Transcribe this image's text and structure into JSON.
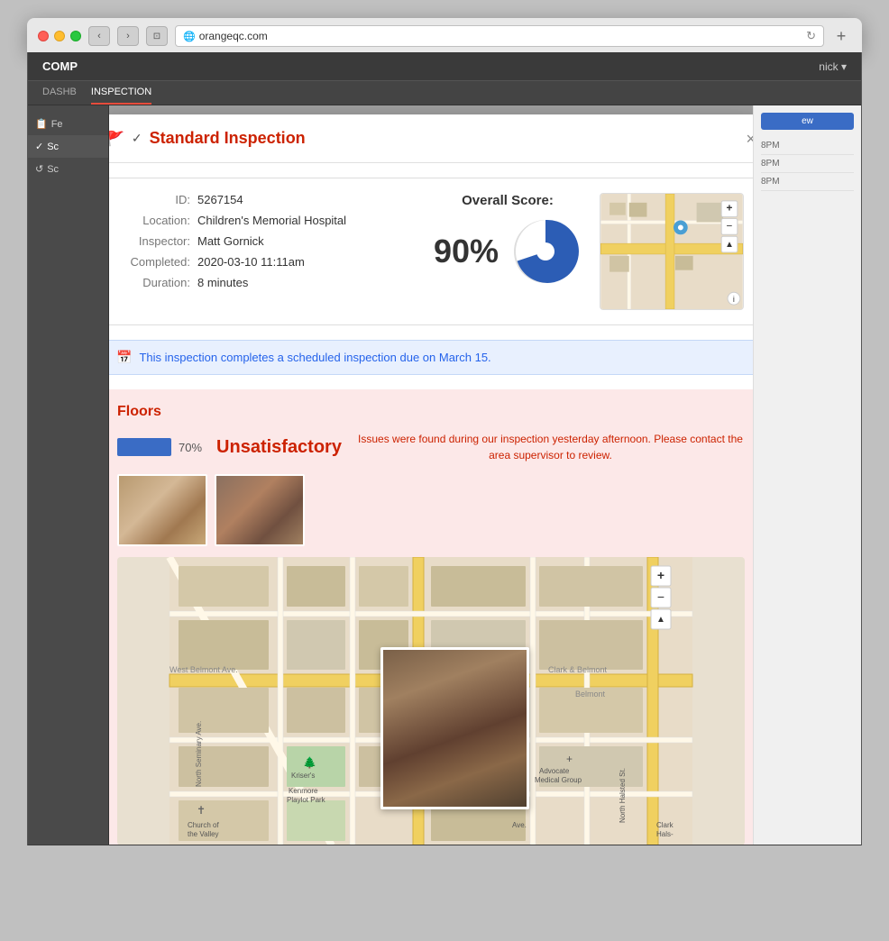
{
  "browser": {
    "url": "orangeqc.com",
    "traffic_lights": [
      "red",
      "yellow",
      "green"
    ]
  },
  "app": {
    "header_text": "COMP",
    "user": "nick ▾",
    "nav_items": [
      "DASHB",
      "INSPECTION"
    ],
    "sidebar_items": [
      "Fe",
      "Sc",
      "Sc"
    ]
  },
  "modal": {
    "title": "Standard Inspection",
    "flag_icon": "🚩",
    "check_icon": "✓",
    "close_icon": "×",
    "info": {
      "id_label": "ID:",
      "id_value": "5267154",
      "location_label": "Location:",
      "location_value": "Children's Memorial Hospital",
      "inspector_label": "Inspector:",
      "inspector_value": "Matt Gornick",
      "completed_label": "Completed:",
      "completed_value": "2020-03-10 11:11am",
      "duration_label": "Duration:",
      "duration_value": "8 minutes"
    },
    "score": {
      "label": "Overall Score:",
      "value": "90%",
      "percent": 90
    },
    "scheduled_notice": "This inspection completes a scheduled inspection due on March 15.",
    "floors": {
      "title": "Floors",
      "score_percent": 70,
      "score_label": "70%",
      "status": "Unsatisfactory",
      "issues_text": "Issues were found during our inspection yesterday afternoon. Please contact the area supervisor to review.",
      "map_zoom_plus": "+",
      "map_zoom_minus": "−",
      "map_zoom_reset": "▲"
    }
  }
}
